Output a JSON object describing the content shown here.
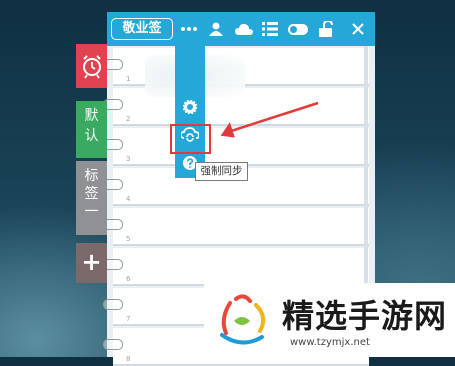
{
  "app": {
    "brand": "敬业签",
    "toolbar_icons": [
      "more-icon",
      "user-icon",
      "cloud-icon",
      "list-icon",
      "toggle-icon",
      "lock-icon",
      "close-icon"
    ]
  },
  "sidebar": {
    "tabs": [
      {
        "name": "alarm",
        "icon": "alarm-clock-icon",
        "color": "#e0434f"
      },
      {
        "name": "default",
        "label_lines": [
          "默",
          "认"
        ],
        "color": "#3aaa61"
      },
      {
        "name": "tag1",
        "label_lines": [
          "标",
          "签",
          "一"
        ],
        "color": "#8f9194"
      },
      {
        "name": "add",
        "label": "+",
        "color": "#7c6a6a"
      }
    ]
  },
  "notes": {
    "row_numbers": [
      "1",
      "2",
      "3",
      "4",
      "5",
      "6",
      "7",
      "8"
    ]
  },
  "menu": {
    "items": [
      "settings-icon",
      "sync-icon",
      "help-icon"
    ],
    "tooltip": "强制同步"
  },
  "watermark": {
    "title": "精选手游网",
    "url": "www.tzymjx.net"
  },
  "colors": {
    "accent": "#25a7d8",
    "highlight": "#e23a3a"
  }
}
